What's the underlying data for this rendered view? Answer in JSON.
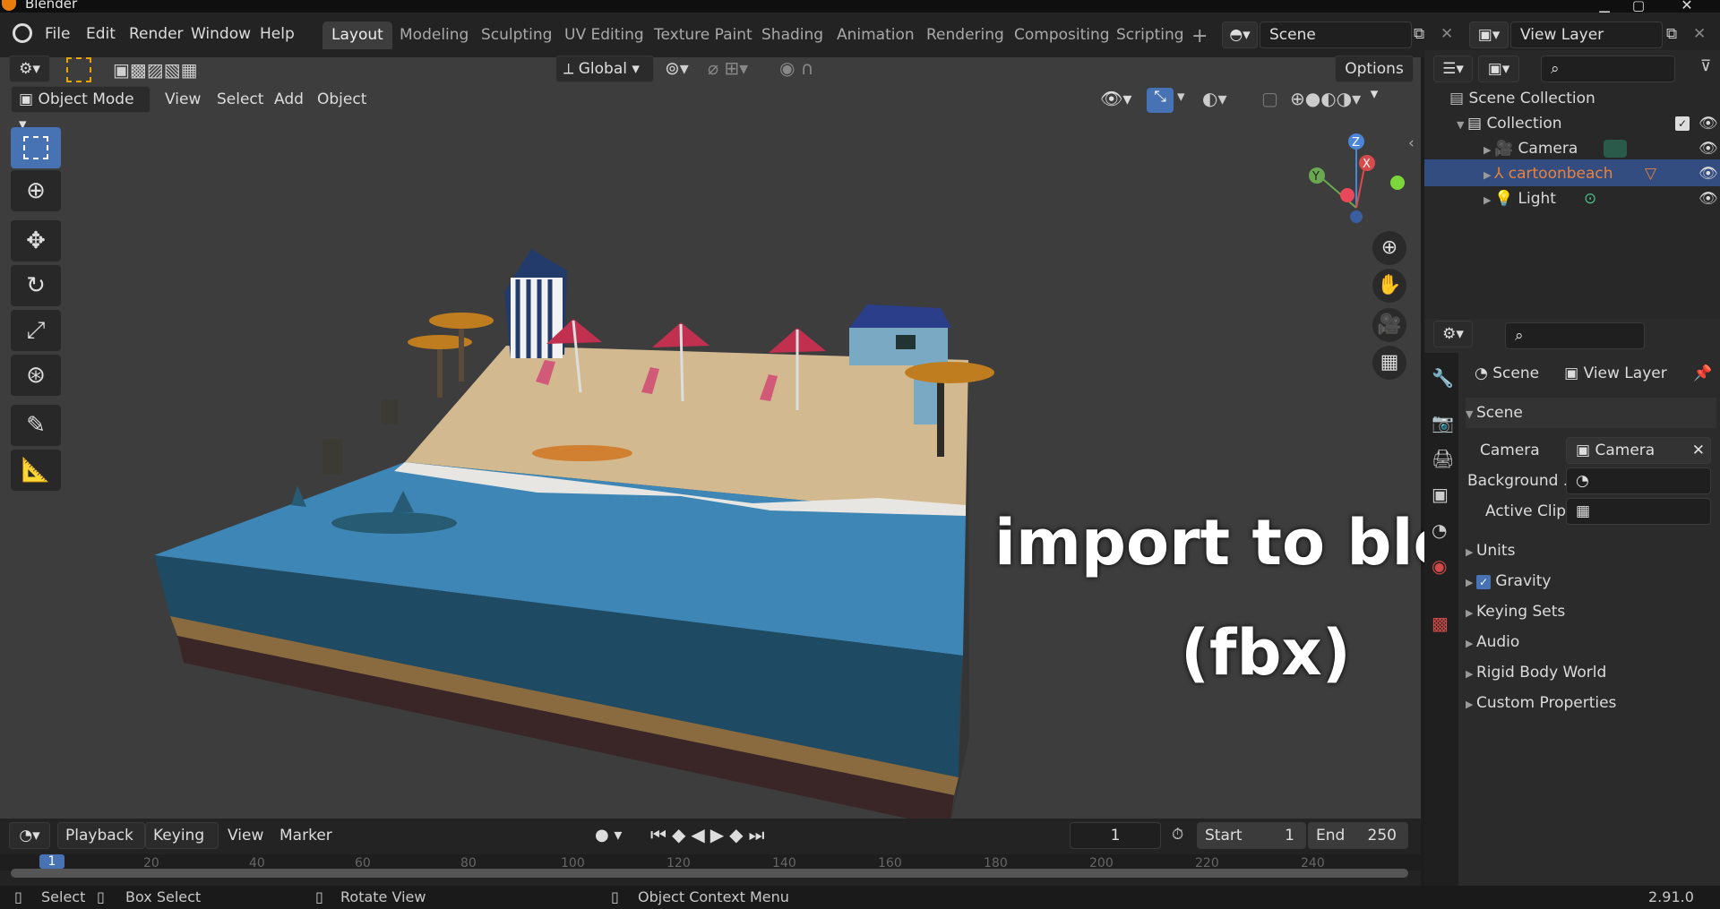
{
  "window": {
    "title": "Blender"
  },
  "menu": [
    "File",
    "Edit",
    "Render",
    "Window",
    "Help"
  ],
  "workspaces": [
    "Layout",
    "Modeling",
    "Sculpting",
    "UV Editing",
    "Texture Paint",
    "Shading",
    "Animation",
    "Rendering",
    "Compositing",
    "Scripting"
  ],
  "active_workspace": "Layout",
  "scene_field": "Scene",
  "view_layer_field": "View Layer",
  "toolbar": {
    "transform_orientation": "Global",
    "options_label": "Options"
  },
  "viewport_header": {
    "mode": "Object Mode",
    "menus": [
      "View",
      "Select",
      "Add",
      "Object"
    ]
  },
  "tools": [
    "select-box",
    "cursor",
    "move",
    "rotate",
    "scale",
    "transform",
    "annotate",
    "measure"
  ],
  "overlay_text": {
    "line1": "import to blender",
    "line2": "(fbx)"
  },
  "outliner": {
    "root": "Scene Collection",
    "collection": "Collection",
    "items": [
      {
        "name": "Camera",
        "color": "#dcdcdc"
      },
      {
        "name": "cartoonbeach",
        "color": "#e8823c"
      },
      {
        "name": "Light",
        "color": "#dcdcdc"
      }
    ]
  },
  "properties": {
    "breadcrumb": [
      "Scene",
      "View Layer"
    ],
    "section": "Scene",
    "camera_label": "Camera",
    "camera_value": "Camera",
    "background_label": "Background ...",
    "active_clip_label": "Active Clip",
    "panels": [
      "Units",
      "Gravity",
      "Keying Sets",
      "Audio",
      "Rigid Body World",
      "Custom Properties"
    ]
  },
  "timeline": {
    "menus": [
      "Playback",
      "Keying",
      "View",
      "Marker"
    ],
    "current_frame": "1",
    "start_label": "Start",
    "start": "1",
    "end_label": "End",
    "end": "250",
    "ruler": [
      "20",
      "40",
      "60",
      "80",
      "100",
      "120",
      "140",
      "160",
      "180",
      "200",
      "220",
      "240"
    ],
    "ruler_marker": "1"
  },
  "statusbar": {
    "select": "Select",
    "box_select": "Box Select",
    "rotate_view": "Rotate View",
    "context_menu": "Object Context Menu",
    "version": "2.91.0"
  },
  "colors": {
    "accent": "#4772b3",
    "selected_object": "#e8823c",
    "water": "#3d86b5",
    "sand": "#d2b98f"
  }
}
